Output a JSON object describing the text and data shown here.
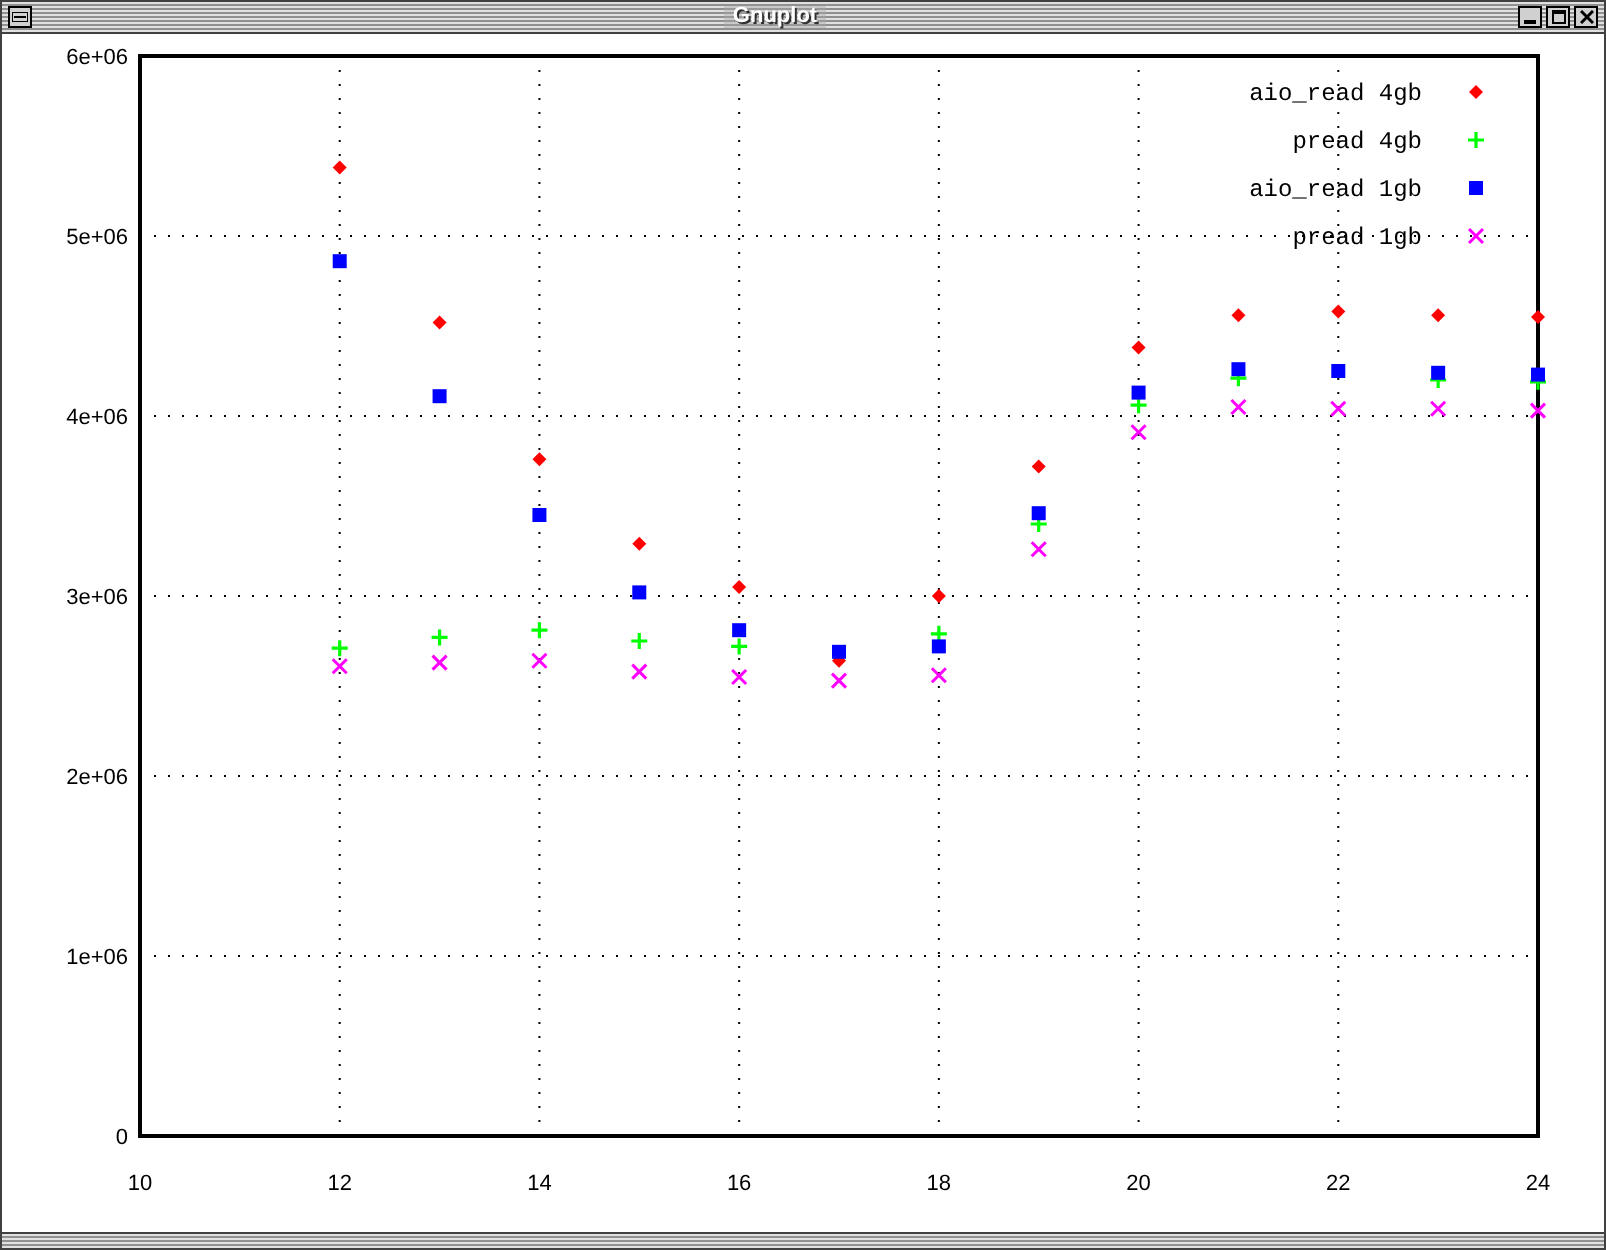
{
  "window": {
    "title": "Gnuplot"
  },
  "plot": {
    "chart_data": {
      "type": "scatter",
      "x": [
        12,
        13,
        14,
        15,
        16,
        17,
        18,
        19,
        20,
        21,
        22,
        23,
        24
      ],
      "series": [
        {
          "name": "aio_read 4gb",
          "color": "#ff0000",
          "values": [
            5380000,
            4520000,
            3760000,
            3290000,
            3050000,
            2640000,
            3000000,
            3720000,
            4380000,
            4560000,
            4580000,
            4560000,
            4550000
          ]
        },
        {
          "name": "pread 4gb",
          "color": "#00ff00",
          "values": [
            2710000,
            2770000,
            2810000,
            2750000,
            2720000,
            null,
            2790000,
            3400000,
            4060000,
            4210000,
            null,
            4200000,
            4190000
          ]
        },
        {
          "name": "aio_read 1gb",
          "color": "#0000ff",
          "values": [
            4860000,
            4110000,
            3450000,
            3020000,
            2810000,
            2690000,
            2720000,
            3460000,
            4130000,
            4260000,
            4250000,
            4240000,
            4230000
          ]
        },
        {
          "name": "pread 1gb",
          "color": "#ff00ff",
          "values": [
            2610000,
            2630000,
            2640000,
            2580000,
            2550000,
            2530000,
            2560000,
            3260000,
            3910000,
            4050000,
            4040000,
            4040000,
            4030000
          ]
        }
      ],
      "grid": true,
      "legend": true,
      "xlim": [
        10,
        24
      ],
      "ylim": [
        0,
        6000000
      ],
      "xticks": [
        10,
        12,
        14,
        16,
        18,
        20,
        22,
        24
      ],
      "yticks": [
        {
          "value": 0,
          "label": "0"
        },
        {
          "value": 1000000,
          "label": "1e+06"
        },
        {
          "value": 2000000,
          "label": "2e+06"
        },
        {
          "value": 3000000,
          "label": "3e+06"
        },
        {
          "value": 4000000,
          "label": "4e+06"
        },
        {
          "value": 5000000,
          "label": "5e+06"
        },
        {
          "value": 6000000,
          "label": "6e+06"
        }
      ]
    }
  }
}
